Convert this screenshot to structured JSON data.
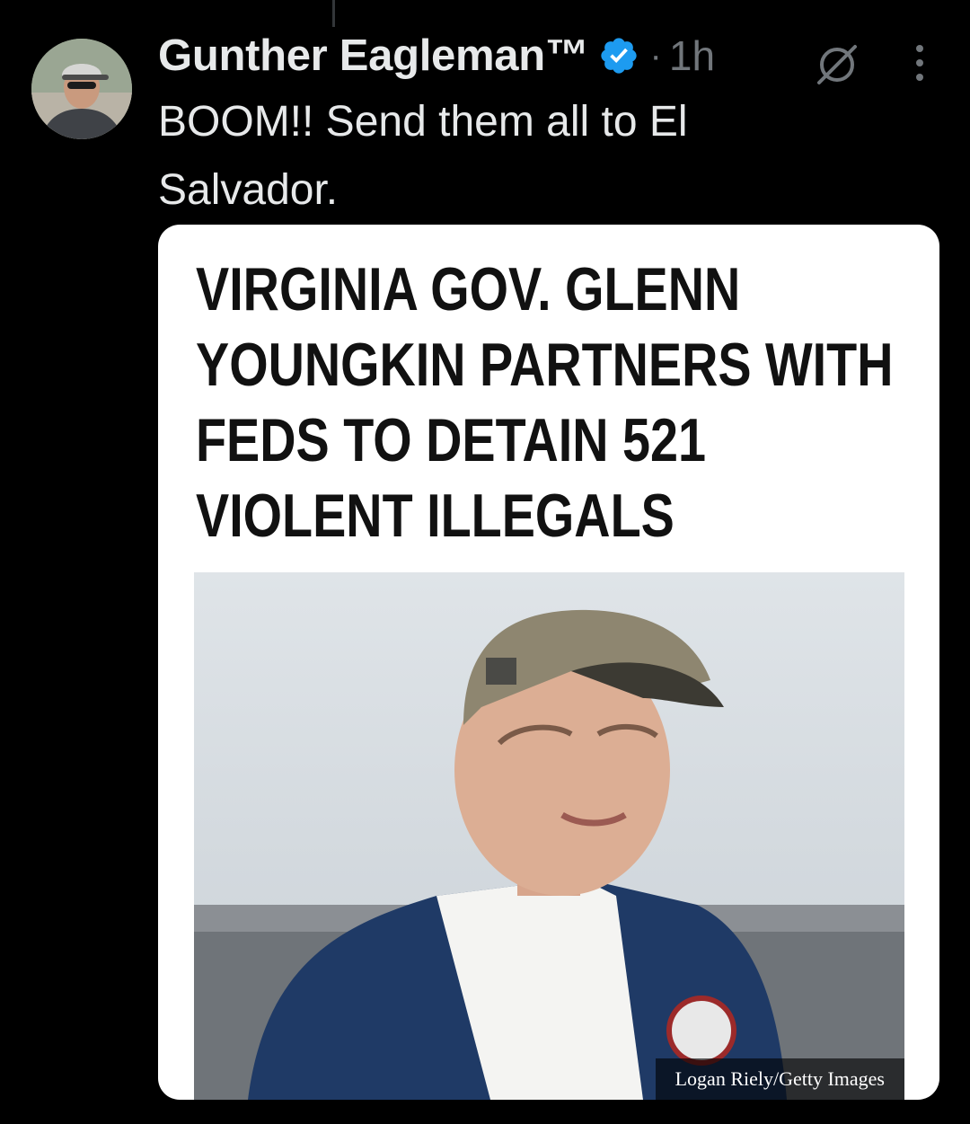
{
  "tweet": {
    "author_name": "Gunther Eagleman™",
    "separator": "·",
    "timestamp": "1h",
    "text_line1": "BOOM!!  Send them all to El",
    "text_line2": "Salvador."
  },
  "card": {
    "headline_lines": [
      "VIRGINIA GOV. GLENN",
      "YOUNGKIN PARTNERS WITH",
      "FEDS TO DETAIN 521",
      "VIOLENT ILLEGALS"
    ],
    "photo_credit": "Logan Riely/Getty Images"
  },
  "icons": {
    "verified": "verified-badge-icon",
    "grok": "grok-icon",
    "more": "more-options-icon"
  },
  "colors": {
    "background": "#000000",
    "text": "#e7e9ea",
    "muted": "#71767b",
    "verified_blue": "#1d9bf0"
  }
}
